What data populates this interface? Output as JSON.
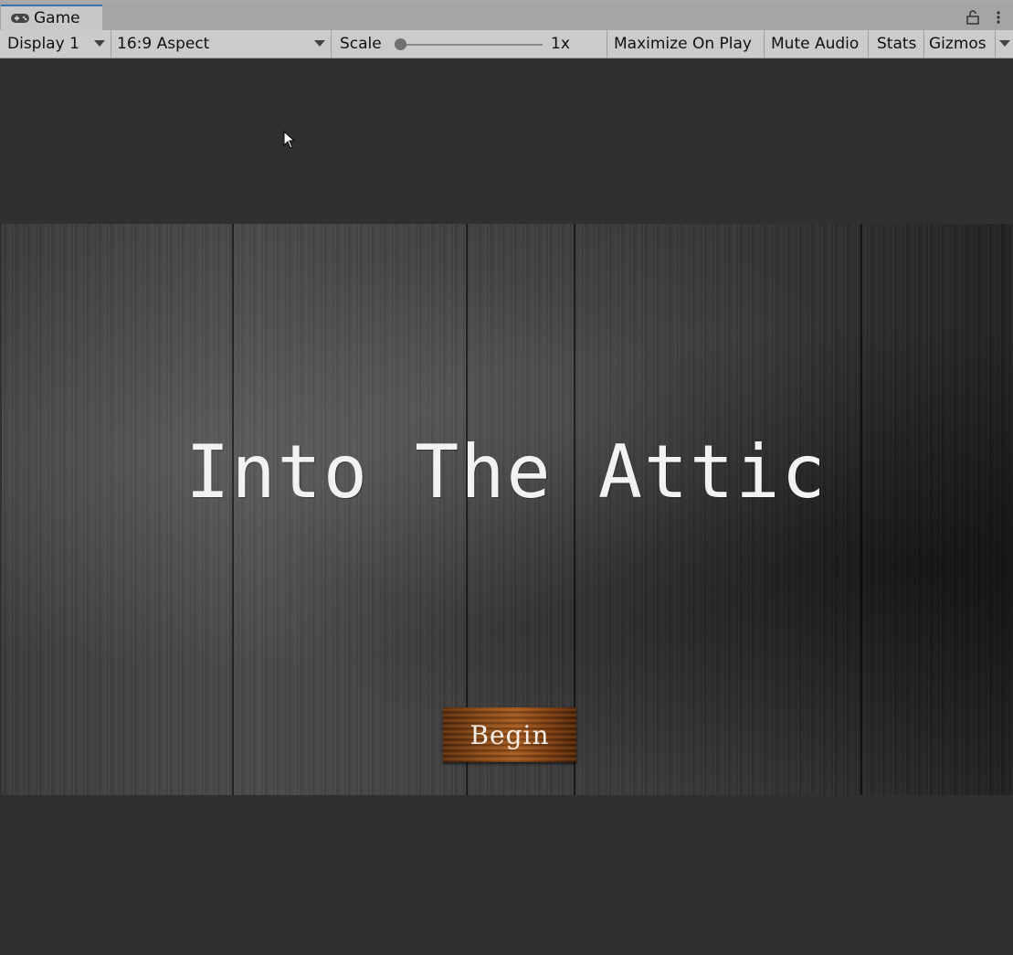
{
  "window": {
    "tab_label": "Game"
  },
  "toolbar": {
    "display": "Display 1",
    "aspect": "16:9 Aspect",
    "scale_label": "Scale",
    "scale_value": "1x",
    "scale_fraction": 0.0,
    "maximize": "Maximize On Play",
    "mute": "Mute Audio",
    "stats": "Stats",
    "gizmos": "Gizmos"
  },
  "game": {
    "title": "Into The Attic",
    "begin_label": "Begin"
  },
  "colors": {
    "editor_background": "#303030",
    "toolbar": "#cbcbcb",
    "tab_active_accent": "#3a72b0",
    "title_text": "#f2f2f2"
  },
  "icons": {
    "tab": "gamepad-icon",
    "lock": "lock-icon",
    "menu": "kebab-menu-icon",
    "cursor": "mouse-cursor-icon"
  }
}
